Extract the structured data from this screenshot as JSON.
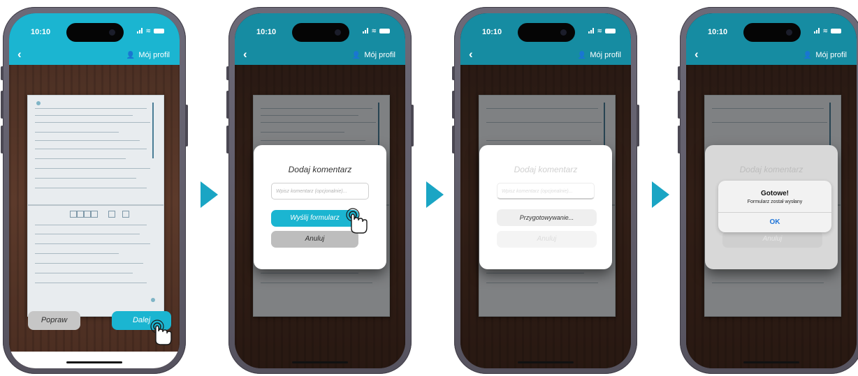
{
  "status_bar": {
    "time": "10:10"
  },
  "nav": {
    "profile_label": "Mój profil"
  },
  "screen1": {
    "popraw_label": "Popraw",
    "dalej_label": "Dalej"
  },
  "screen2": {
    "title": "Dodaj komentarz",
    "input_placeholder": "Wpisz komentarz (opcjonalnie)...",
    "send_label": "Wyślij formularz",
    "cancel_label": "Anuluj"
  },
  "screen3": {
    "title": "Dodaj komentarz",
    "input_placeholder": "Wpisz komentarz (opcjonalnie)...",
    "preparing_label": "Przygotowywanie...",
    "cancel_label": "Anuluj"
  },
  "screen4": {
    "title": "Dodaj komentarz",
    "cancel_label": "Anuluj",
    "alert_title": "Gotowe!",
    "alert_message": "Formularz został wysłany",
    "alert_ok": "OK"
  },
  "colors": {
    "accent": "#1bb5d1",
    "arrow": "#1aa5c4",
    "secondary_button": "#c6c6c6"
  }
}
